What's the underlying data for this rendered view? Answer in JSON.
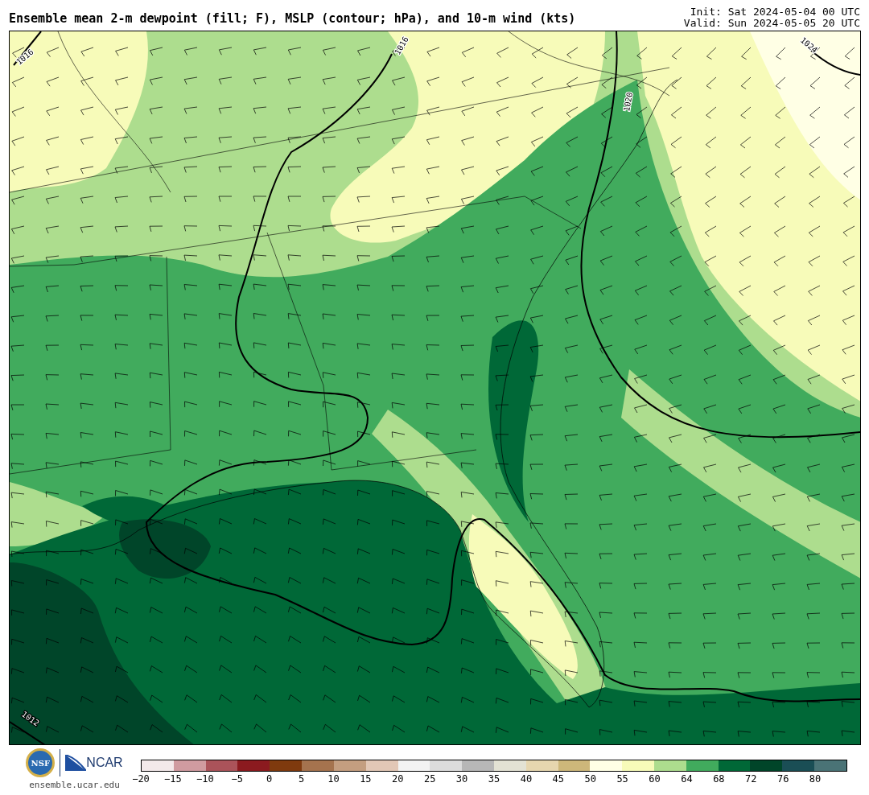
{
  "title": "Ensemble mean 2-m dewpoint (fill; F), MSLP (contour; hPa), and 10-m wind (kts)",
  "init": "Init: Sat 2024-05-04 00 UTC",
  "valid": "Valid: Sun 2024-05-05 20 UTC",
  "map": {
    "contour_labels": [
      {
        "text": "1016",
        "kind": "nw"
      },
      {
        "text": "1016",
        "kind": "north"
      },
      {
        "text": "1020",
        "kind": "east"
      },
      {
        "text": "1024",
        "kind": "ne"
      },
      {
        "text": "1012",
        "kind": "sw"
      }
    ]
  },
  "logos": {
    "nsf": "NSF",
    "ncar": "NCAR",
    "site": "ensemble.ucar.edu"
  },
  "colorbar": {
    "segments": [
      {
        "color": "#f3e9ea"
      },
      {
        "color": "#d09ba0"
      },
      {
        "color": "#ab535a"
      },
      {
        "color": "#8b1a1f"
      },
      {
        "color": "#7f3a0e"
      },
      {
        "color": "#a5734e"
      },
      {
        "color": "#c49e80"
      },
      {
        "color": "#e2c7b6"
      },
      {
        "color": "#f2f2f2"
      },
      {
        "color": "#dcdcdc"
      },
      {
        "color": "#b7b7b7"
      },
      {
        "color": "#e3e2d4"
      },
      {
        "color": "#e6d6af"
      },
      {
        "color": "#cdb77a"
      },
      {
        "color": "#ffffe5"
      },
      {
        "color": "#f7fbb9"
      },
      {
        "color": "#addd8e"
      },
      {
        "color": "#41ab5d"
      },
      {
        "color": "#006837"
      },
      {
        "color": "#004529"
      },
      {
        "color": "#1a4e55"
      },
      {
        "color": "#4a7376"
      }
    ],
    "ticks": [
      "−20",
      "−15",
      "−10",
      "−5",
      "0",
      "5",
      "10",
      "15",
      "20",
      "25",
      "30",
      "35",
      "40",
      "45",
      "50",
      "55",
      "60",
      "64",
      "68",
      "72",
      "76",
      "80"
    ]
  }
}
